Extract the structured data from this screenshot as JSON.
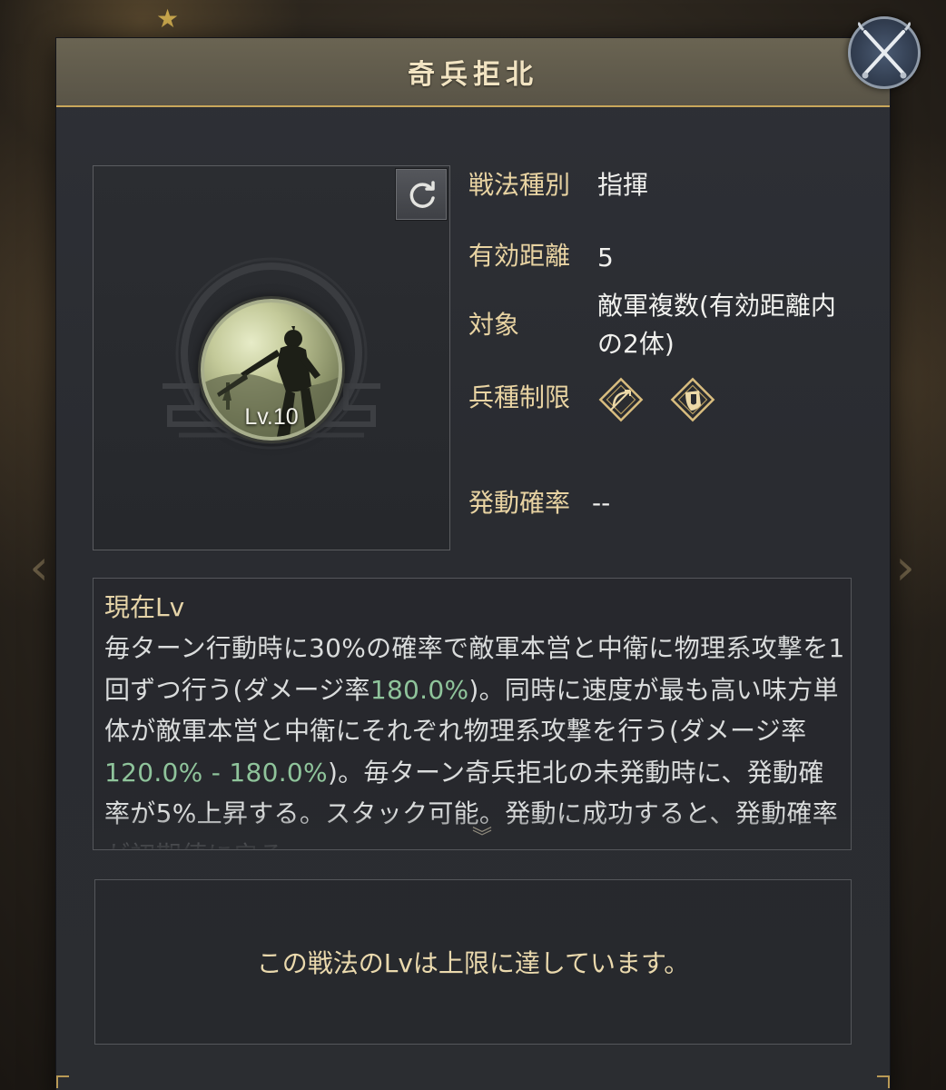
{
  "window": {
    "title": "奇兵拒北"
  },
  "skill": {
    "level": "Lv.10"
  },
  "info": {
    "rows": [
      {
        "label": "戦法種別",
        "value": "指揮"
      },
      {
        "label": "有効距離",
        "value": "5"
      },
      {
        "label": "対象",
        "value": "敵軍複数(有効距離内の2体)"
      },
      {
        "label": "兵種制限",
        "value": ""
      },
      {
        "label": "発動確率",
        "value": "--"
      }
    ],
    "troop_icons": [
      "bow-icon",
      "shield-icon"
    ]
  },
  "description": {
    "heading": "現在Lv",
    "text_parts": [
      "毎ターン行動時に30%の確率で敵軍本営と中衛に物理系攻撃を1回ずつ行う(ダメージ率",
      "180.0%",
      ")。同時に速度が最も高い味方単体が敵軍本営と中衛にそれぞれ物理系攻撃を行う(ダメージ率",
      "120.0% - 180.0%",
      ")。毎ターン奇兵拒北の未発動時に、発動確率が5%上昇する。スタック可能。発動に成功すると、発動確率が初期値に戻る。"
    ],
    "highlight_color": "#8fc49b"
  },
  "max_level": {
    "message": "この戦法のLvは上限に達しています。"
  },
  "colors": {
    "label": "#e8d3a2",
    "accent": "#c9a75b",
    "panel": "#2b2d31"
  }
}
